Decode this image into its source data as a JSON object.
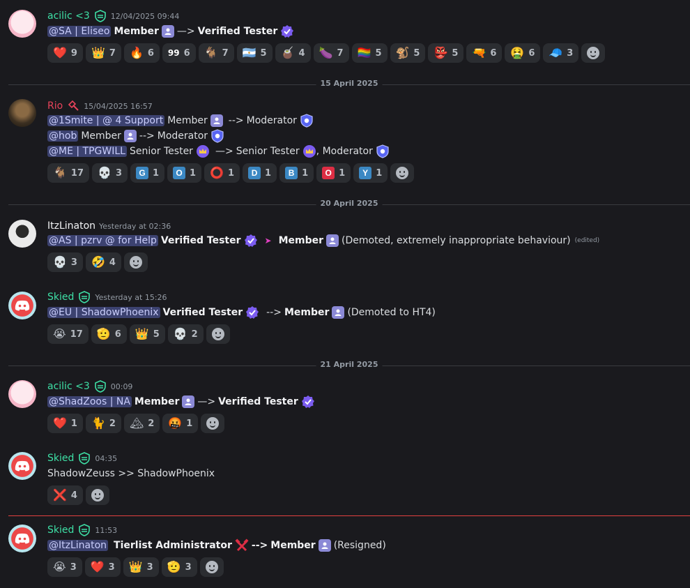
{
  "messages": [
    {
      "author": "acilic <3",
      "author_color": "#3ee0a6",
      "timestamp": "12/04/2025 09:44",
      "mention": "@SA | Eliseo",
      "from_role": "Member",
      "arrow": "—>",
      "to_role": "Verified Tester",
      "reactions": [
        {
          "emoji": "❤️",
          "count": "9"
        },
        {
          "emoji": "👑",
          "count": "7"
        },
        {
          "emoji": "🔥",
          "count": "6"
        },
        {
          "emoji": "99",
          "count": "6"
        },
        {
          "emoji": "🐐",
          "count": "7"
        },
        {
          "emoji": "🇦🇷",
          "count": "5"
        },
        {
          "emoji": "🧉",
          "count": "4"
        },
        {
          "emoji": "🍆",
          "count": "7"
        },
        {
          "emoji": "🏳️‍🌈",
          "count": "5"
        },
        {
          "emoji": "🐒",
          "count": "5"
        },
        {
          "emoji": "👺",
          "count": "5"
        },
        {
          "emoji": "🔫",
          "count": "6"
        },
        {
          "emoji": "🤮",
          "count": "6"
        },
        {
          "emoji": "🧢",
          "count": "3"
        }
      ]
    },
    {
      "author": "Rio",
      "author_color": "#e8435a",
      "timestamp": "15/04/2025 16:57",
      "lines": [
        {
          "mention": "@1Smite | @ 4 Support",
          "from": "Member",
          "arrow": "-->",
          "to": "Moderator"
        },
        {
          "mention": "@hob",
          "from": "Member",
          "arrow": "-->",
          "to": "Moderator"
        },
        {
          "mention": "@ME | TPGWILL",
          "from": "Senior Tester",
          "arrow": "—>",
          "to": "Senior Tester",
          "extra": ", Moderator"
        }
      ],
      "reactions": [
        {
          "emoji": "🐐",
          "count": "17"
        },
        {
          "emoji": "💀",
          "count": "3"
        },
        {
          "emoji": "G",
          "count": "1"
        },
        {
          "emoji": "O",
          "count": "1"
        },
        {
          "emoji": "⭕",
          "count": "1"
        },
        {
          "emoji": "D",
          "count": "1"
        },
        {
          "emoji": "B",
          "count": "1"
        },
        {
          "emoji": "O",
          "count": "1"
        },
        {
          "emoji": "Y",
          "count": "1"
        }
      ]
    },
    {
      "author": "ItzLinaton",
      "author_color": "#f2f3f5",
      "timestamp": "Yesterday at 02:36",
      "mention": "@AS  | pzrv @ for Help",
      "from_role": "Verified Tester",
      "arrow": "➤",
      "to_role": "Member",
      "note": "(Demoted, extremely inappropriate behaviour)",
      "edited": "(edited)",
      "reactions": [
        {
          "emoji": "💀",
          "count": "3"
        },
        {
          "emoji": "🤣",
          "count": "4"
        }
      ]
    },
    {
      "author": "Skied",
      "author_color": "#3ee0a6",
      "timestamp": "Yesterday at 15:26",
      "mention": "@EU | ShadowPhoenix",
      "from_role": "Verified Tester",
      "arrow": "-->",
      "to_role": "Member",
      "note": "(Demoted to HT4)",
      "reactions": [
        {
          "emoji": "😭",
          "count": "17"
        },
        {
          "emoji": "🫡",
          "count": "6"
        },
        {
          "emoji": "👑",
          "count": "5"
        },
        {
          "emoji": "💀",
          "count": "2"
        }
      ]
    },
    {
      "author": "acilic <3",
      "author_color": "#3ee0a6",
      "timestamp": "00:09",
      "mention": "@ShadZoos | NA",
      "from_role": "Member",
      "arrow": "—>",
      "to_role": "Verified Tester",
      "reactions": [
        {
          "emoji": "❤️",
          "count": "1"
        },
        {
          "emoji": "🐈",
          "count": "2"
        },
        {
          "emoji": "🏔",
          "count": "2"
        },
        {
          "emoji": "🤬",
          "count": "1"
        }
      ]
    },
    {
      "author": "Skied",
      "author_color": "#3ee0a6",
      "timestamp": "04:35",
      "text": "ShadowZeuss >> ShadowPhoenix",
      "reactions": [
        {
          "emoji": "❌",
          "count": "4"
        }
      ]
    },
    {
      "author": "Skied",
      "author_color": "#3ee0a6",
      "timestamp": "11:53",
      "mention": "@ItzLinaton",
      "from_role": "Tierlist Administrator",
      "arrow": "-->",
      "to_role": "Member",
      "note": "(Resigned)",
      "reactions": [
        {
          "emoji": "😭",
          "count": "3"
        },
        {
          "emoji": "❤️",
          "count": "3"
        },
        {
          "emoji": "👑",
          "count": "3"
        },
        {
          "emoji": "🫡",
          "count": "3"
        }
      ]
    }
  ],
  "dividers": [
    "15 April 2025",
    "20 April 2025",
    "21 April 2025"
  ]
}
